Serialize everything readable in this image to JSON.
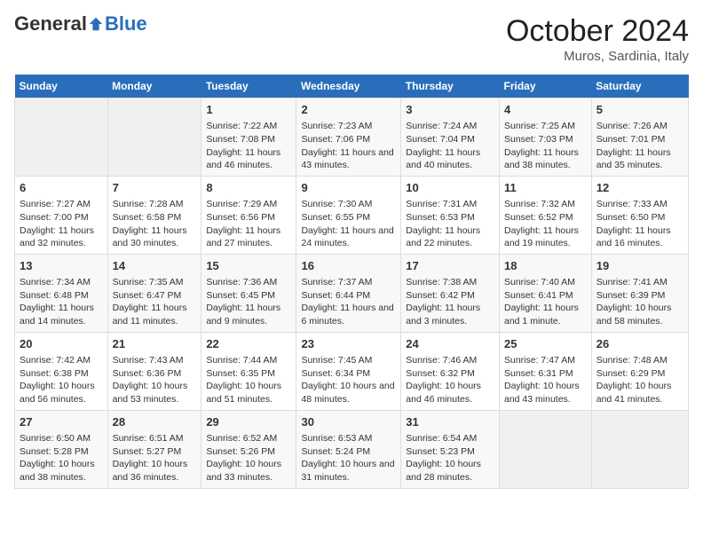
{
  "header": {
    "logo_general": "General",
    "logo_blue": "Blue",
    "month_title": "October 2024",
    "location": "Muros, Sardinia, Italy"
  },
  "days_of_week": [
    "Sunday",
    "Monday",
    "Tuesday",
    "Wednesday",
    "Thursday",
    "Friday",
    "Saturday"
  ],
  "weeks": [
    [
      null,
      null,
      {
        "day": "1",
        "sunrise": "Sunrise: 7:22 AM",
        "sunset": "Sunset: 7:08 PM",
        "daylight": "Daylight: 11 hours and 46 minutes."
      },
      {
        "day": "2",
        "sunrise": "Sunrise: 7:23 AM",
        "sunset": "Sunset: 7:06 PM",
        "daylight": "Daylight: 11 hours and 43 minutes."
      },
      {
        "day": "3",
        "sunrise": "Sunrise: 7:24 AM",
        "sunset": "Sunset: 7:04 PM",
        "daylight": "Daylight: 11 hours and 40 minutes."
      },
      {
        "day": "4",
        "sunrise": "Sunrise: 7:25 AM",
        "sunset": "Sunset: 7:03 PM",
        "daylight": "Daylight: 11 hours and 38 minutes."
      },
      {
        "day": "5",
        "sunrise": "Sunrise: 7:26 AM",
        "sunset": "Sunset: 7:01 PM",
        "daylight": "Daylight: 11 hours and 35 minutes."
      }
    ],
    [
      {
        "day": "6",
        "sunrise": "Sunrise: 7:27 AM",
        "sunset": "Sunset: 7:00 PM",
        "daylight": "Daylight: 11 hours and 32 minutes."
      },
      {
        "day": "7",
        "sunrise": "Sunrise: 7:28 AM",
        "sunset": "Sunset: 6:58 PM",
        "daylight": "Daylight: 11 hours and 30 minutes."
      },
      {
        "day": "8",
        "sunrise": "Sunrise: 7:29 AM",
        "sunset": "Sunset: 6:56 PM",
        "daylight": "Daylight: 11 hours and 27 minutes."
      },
      {
        "day": "9",
        "sunrise": "Sunrise: 7:30 AM",
        "sunset": "Sunset: 6:55 PM",
        "daylight": "Daylight: 11 hours and 24 minutes."
      },
      {
        "day": "10",
        "sunrise": "Sunrise: 7:31 AM",
        "sunset": "Sunset: 6:53 PM",
        "daylight": "Daylight: 11 hours and 22 minutes."
      },
      {
        "day": "11",
        "sunrise": "Sunrise: 7:32 AM",
        "sunset": "Sunset: 6:52 PM",
        "daylight": "Daylight: 11 hours and 19 minutes."
      },
      {
        "day": "12",
        "sunrise": "Sunrise: 7:33 AM",
        "sunset": "Sunset: 6:50 PM",
        "daylight": "Daylight: 11 hours and 16 minutes."
      }
    ],
    [
      {
        "day": "13",
        "sunrise": "Sunrise: 7:34 AM",
        "sunset": "Sunset: 6:48 PM",
        "daylight": "Daylight: 11 hours and 14 minutes."
      },
      {
        "day": "14",
        "sunrise": "Sunrise: 7:35 AM",
        "sunset": "Sunset: 6:47 PM",
        "daylight": "Daylight: 11 hours and 11 minutes."
      },
      {
        "day": "15",
        "sunrise": "Sunrise: 7:36 AM",
        "sunset": "Sunset: 6:45 PM",
        "daylight": "Daylight: 11 hours and 9 minutes."
      },
      {
        "day": "16",
        "sunrise": "Sunrise: 7:37 AM",
        "sunset": "Sunset: 6:44 PM",
        "daylight": "Daylight: 11 hours and 6 minutes."
      },
      {
        "day": "17",
        "sunrise": "Sunrise: 7:38 AM",
        "sunset": "Sunset: 6:42 PM",
        "daylight": "Daylight: 11 hours and 3 minutes."
      },
      {
        "day": "18",
        "sunrise": "Sunrise: 7:40 AM",
        "sunset": "Sunset: 6:41 PM",
        "daylight": "Daylight: 11 hours and 1 minute."
      },
      {
        "day": "19",
        "sunrise": "Sunrise: 7:41 AM",
        "sunset": "Sunset: 6:39 PM",
        "daylight": "Daylight: 10 hours and 58 minutes."
      }
    ],
    [
      {
        "day": "20",
        "sunrise": "Sunrise: 7:42 AM",
        "sunset": "Sunset: 6:38 PM",
        "daylight": "Daylight: 10 hours and 56 minutes."
      },
      {
        "day": "21",
        "sunrise": "Sunrise: 7:43 AM",
        "sunset": "Sunset: 6:36 PM",
        "daylight": "Daylight: 10 hours and 53 minutes."
      },
      {
        "day": "22",
        "sunrise": "Sunrise: 7:44 AM",
        "sunset": "Sunset: 6:35 PM",
        "daylight": "Daylight: 10 hours and 51 minutes."
      },
      {
        "day": "23",
        "sunrise": "Sunrise: 7:45 AM",
        "sunset": "Sunset: 6:34 PM",
        "daylight": "Daylight: 10 hours and 48 minutes."
      },
      {
        "day": "24",
        "sunrise": "Sunrise: 7:46 AM",
        "sunset": "Sunset: 6:32 PM",
        "daylight": "Daylight: 10 hours and 46 minutes."
      },
      {
        "day": "25",
        "sunrise": "Sunrise: 7:47 AM",
        "sunset": "Sunset: 6:31 PM",
        "daylight": "Daylight: 10 hours and 43 minutes."
      },
      {
        "day": "26",
        "sunrise": "Sunrise: 7:48 AM",
        "sunset": "Sunset: 6:29 PM",
        "daylight": "Daylight: 10 hours and 41 minutes."
      }
    ],
    [
      {
        "day": "27",
        "sunrise": "Sunrise: 6:50 AM",
        "sunset": "Sunset: 5:28 PM",
        "daylight": "Daylight: 10 hours and 38 minutes."
      },
      {
        "day": "28",
        "sunrise": "Sunrise: 6:51 AM",
        "sunset": "Sunset: 5:27 PM",
        "daylight": "Daylight: 10 hours and 36 minutes."
      },
      {
        "day": "29",
        "sunrise": "Sunrise: 6:52 AM",
        "sunset": "Sunset: 5:26 PM",
        "daylight": "Daylight: 10 hours and 33 minutes."
      },
      {
        "day": "30",
        "sunrise": "Sunrise: 6:53 AM",
        "sunset": "Sunset: 5:24 PM",
        "daylight": "Daylight: 10 hours and 31 minutes."
      },
      {
        "day": "31",
        "sunrise": "Sunrise: 6:54 AM",
        "sunset": "Sunset: 5:23 PM",
        "daylight": "Daylight: 10 hours and 28 minutes."
      },
      null,
      null
    ]
  ]
}
